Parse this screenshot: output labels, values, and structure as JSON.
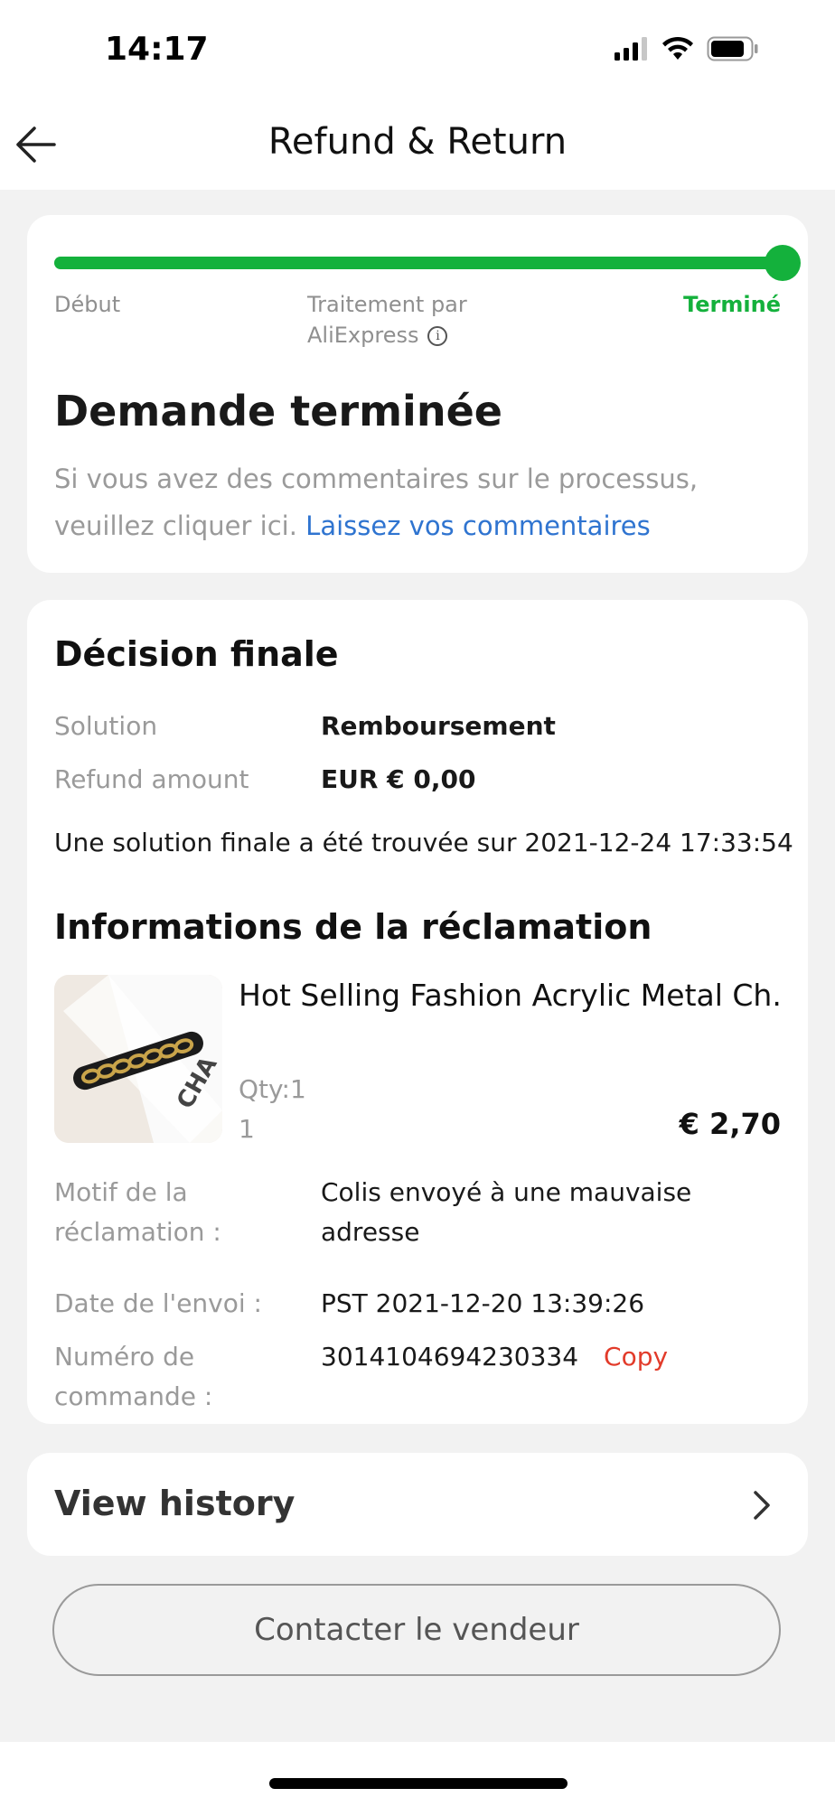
{
  "status_bar": {
    "time": "14:17",
    "icons": [
      "signal-icon",
      "wifi-icon",
      "battery-icon"
    ]
  },
  "header": {
    "title": "Refund & Return",
    "back_icon": "arrow-left-icon"
  },
  "progress": {
    "level": 1.0,
    "accent_color": "#14b13c",
    "steps": [
      {
        "label": "Début"
      },
      {
        "label": "Traitement par",
        "label2": "AliExpress",
        "info_icon": "info-icon"
      },
      {
        "label": "Terminé"
      }
    ]
  },
  "status": {
    "title": "Demande terminée",
    "description": "Si vous avez des commentaires sur le processus, veuillez cliquer ici.",
    "link": "Laissez vos commentaires",
    "link_color": "#2f74d0"
  },
  "decision": {
    "title": "Décision finale",
    "rows": [
      {
        "label": "Solution",
        "value": "Remboursement"
      },
      {
        "label": "Refund amount",
        "value": "EUR € 0,00"
      }
    ],
    "note": "Une solution finale a été trouvée sur 2021-12-24 17:33:54"
  },
  "claim": {
    "title": "Informations de la réclamation",
    "product": {
      "name": "Hot Selling Fashion Acrylic Metal Ch...",
      "qty": "Qty:1",
      "qty_line2": "1",
      "price": "€ 2,70"
    },
    "reason_label_1": "Motif de la",
    "reason_label_2": "réclamation :",
    "reason_value_1": "Colis envoyé à une mauvaise",
    "reason_value_2": "adresse",
    "ship_date_label": "Date de l'envoi :",
    "ship_date_value": "PST 2021-12-20 13:39:26",
    "order_label_1": "Numéro de",
    "order_label_2": "commande :",
    "order_value": "3014104694230334",
    "copy_label": "Copy",
    "copy_color": "#e23b2a"
  },
  "history": {
    "label": "View history",
    "chevron_icon": "chevron-right-icon"
  },
  "contact_button": {
    "label": "Contacter le vendeur"
  }
}
